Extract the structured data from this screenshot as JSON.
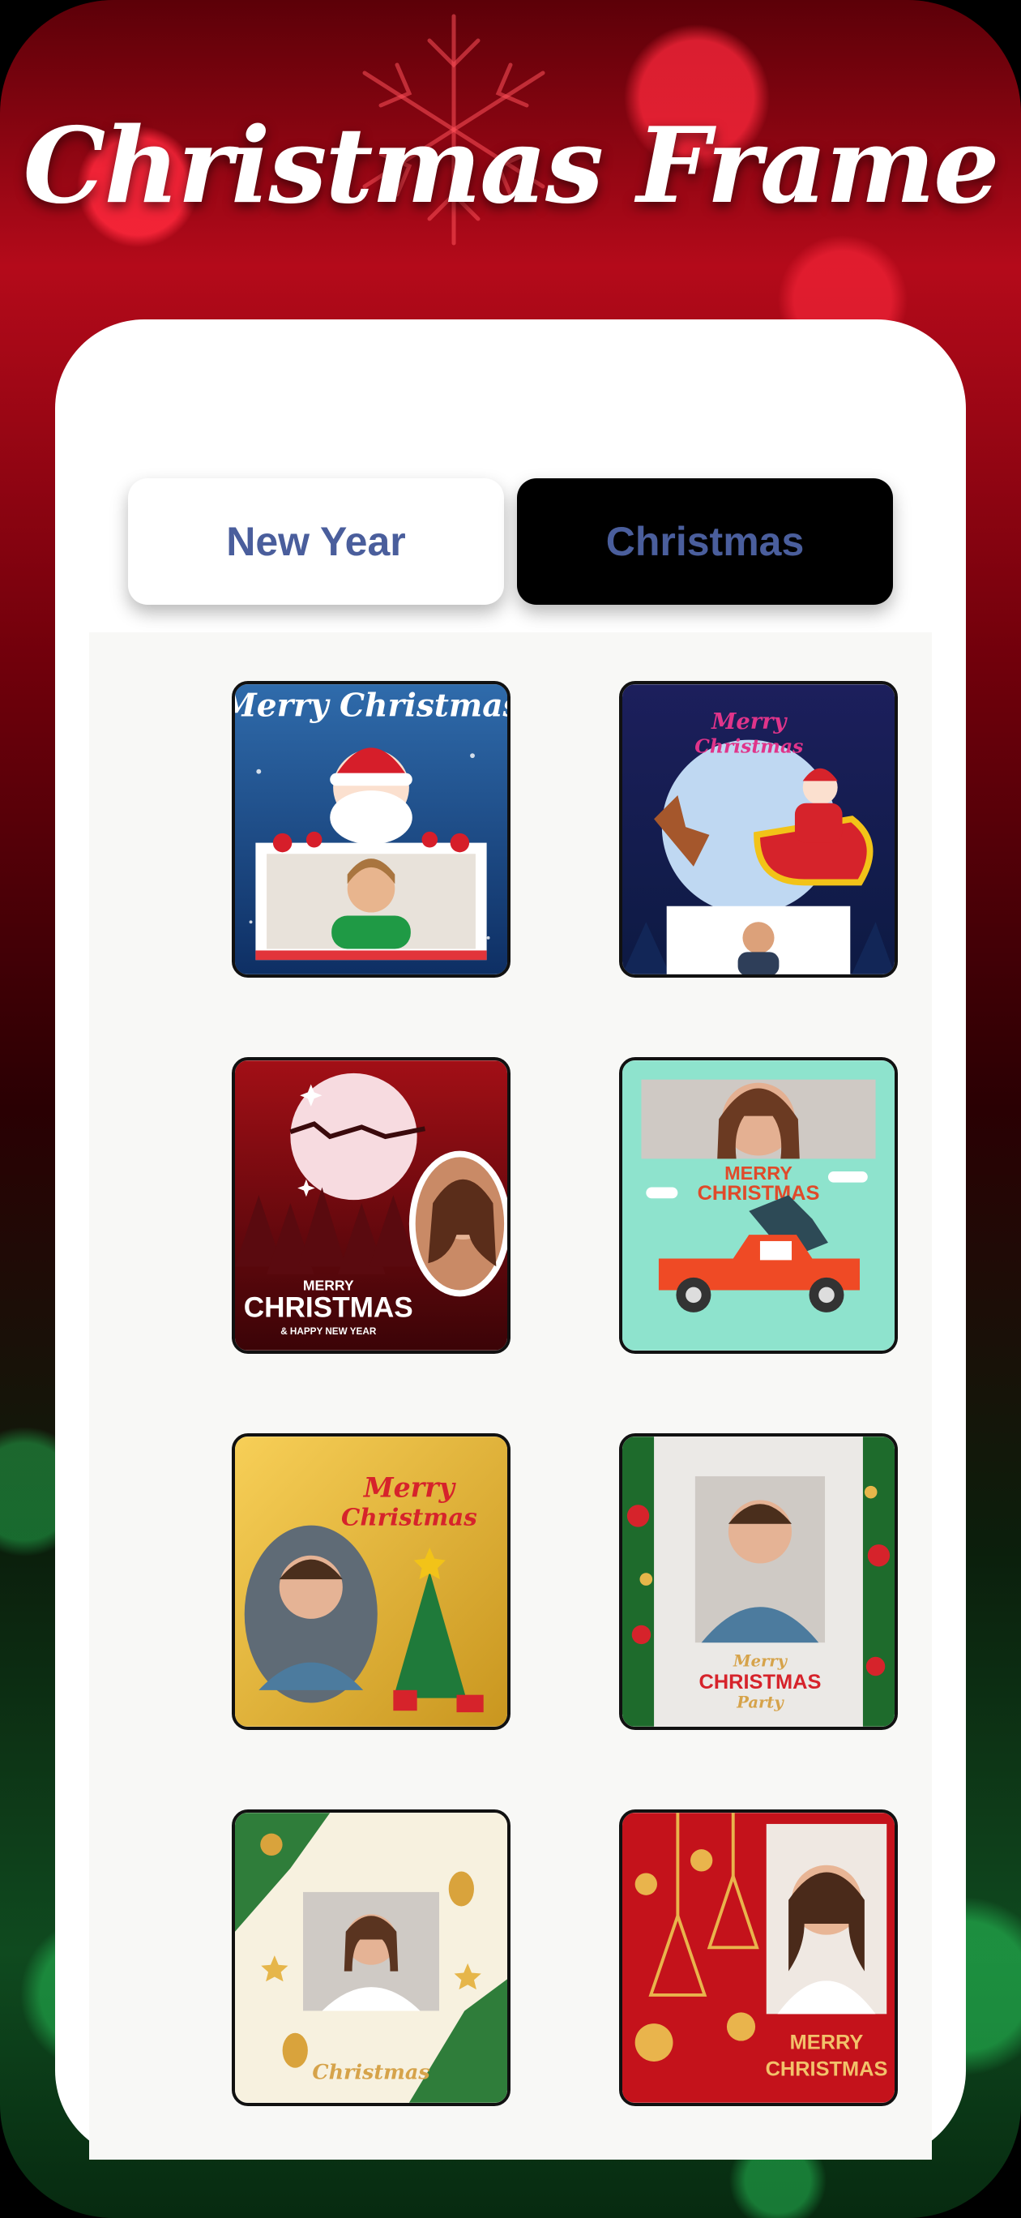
{
  "header": {
    "title": "Christmas Frame"
  },
  "tabs": [
    {
      "label": "New Year",
      "selected": false
    },
    {
      "label": "Christmas",
      "selected": true
    }
  ],
  "frames": [
    {
      "id": 1,
      "text_top": "Merry Christmas",
      "theme": "santa-blue"
    },
    {
      "id": 2,
      "text_top": "Merry",
      "text_bottom": "Christmas",
      "theme": "sleigh-night"
    },
    {
      "id": 3,
      "text_top": "MERRY",
      "text_main": "CHRISTMAS",
      "text_sub": "& HAPPY NEW YEAR",
      "theme": "red-forest"
    },
    {
      "id": 4,
      "text_top": "MERRY",
      "text_bottom": "CHRISTMAS",
      "theme": "mint-truck"
    },
    {
      "id": 5,
      "text_top": "Merry",
      "text_bottom": "Christmas",
      "theme": "gold-tree"
    },
    {
      "id": 6,
      "text_top": "Merry",
      "text_main": "CHRISTMAS",
      "text_sub": "Party",
      "theme": "garland"
    },
    {
      "id": 7,
      "text_top": "Christmas",
      "theme": "cream-ornaments"
    },
    {
      "id": 8,
      "text_top": "MERRY",
      "text_bottom": "CHRISTMAS",
      "theme": "red-gold"
    }
  ],
  "colors": {
    "accent_text": "#4a5e9c",
    "selected_tab_bg": "#000000",
    "panel_bg": "#f8f8f6"
  }
}
